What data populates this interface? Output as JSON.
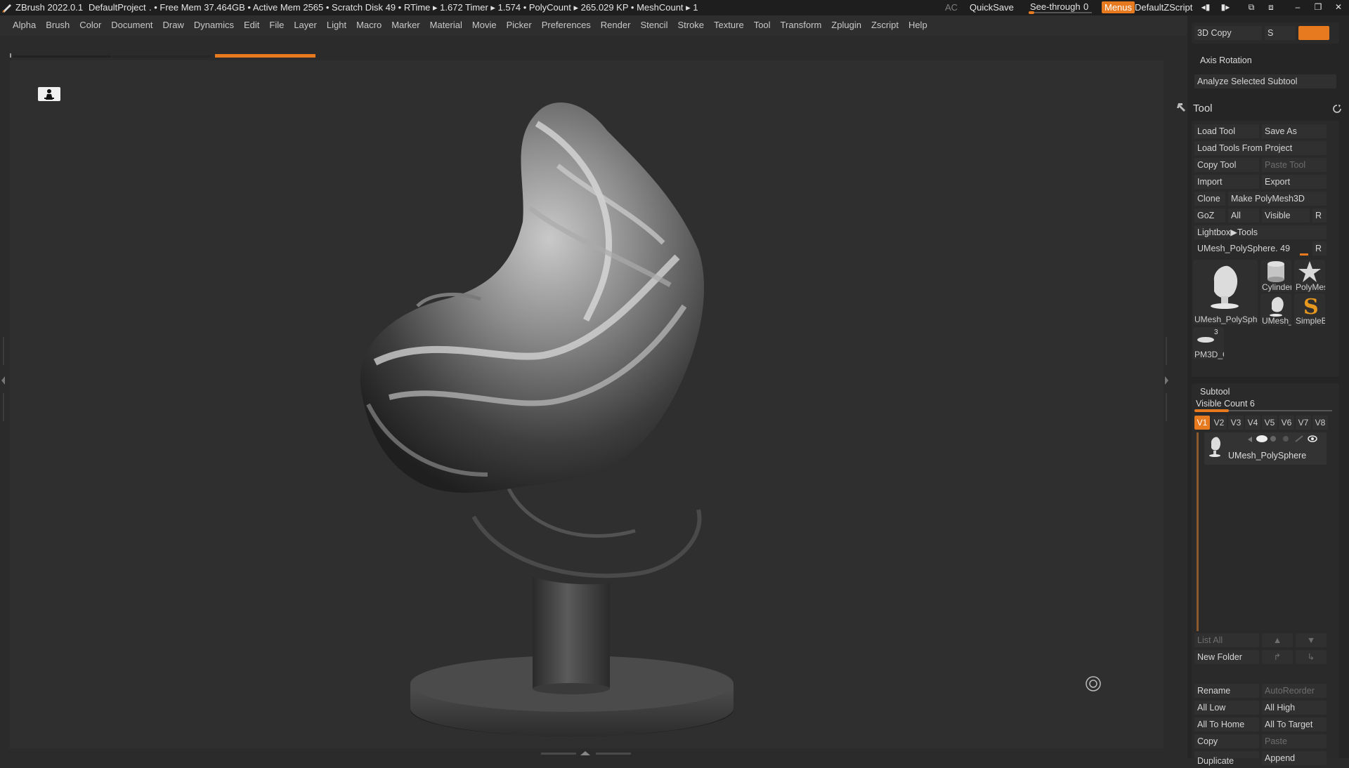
{
  "titlebar": {
    "app_title": "ZBrush 2022.0.1",
    "project": "DefaultProject",
    "stats": ". • Free Mem 37.464GB • Active Mem 2565 • Scratch Disk 49 •  RTime ▸ 1.672 Timer ▸ 1.574 • PolyCount ▸ 265.029 KP  • MeshCount ▸ 1",
    "ac": "AC",
    "quicksave": "QuickSave",
    "see_through_label": "See-through",
    "see_through_value": "0",
    "menus": "Menus",
    "script": "DefaultZScript"
  },
  "menubar": [
    "Alpha",
    "Brush",
    "Color",
    "Document",
    "Draw",
    "Dynamics",
    "Edit",
    "File",
    "Layer",
    "Light",
    "Macro",
    "Marker",
    "Material",
    "Movie",
    "Picker",
    "Preferences",
    "Render",
    "Stencil",
    "Stroke",
    "Texture",
    "Tool",
    "Transform",
    "Zplugin",
    "Zscript",
    "Help"
  ],
  "tray": {
    "top": {
      "copy3d": "3D Copy",
      "s": "S",
      "axis_rotation": "Axis Rotation",
      "analyze": "Analyze Selected Subtool"
    },
    "tool": {
      "title": "Tool",
      "load_tool": "Load Tool",
      "save_as": "Save As",
      "load_from_project": "Load Tools From Project",
      "copy_tool": "Copy Tool",
      "paste_tool": "Paste Tool",
      "import": "Import",
      "export": "Export",
      "clone": "Clone",
      "make_polymesh": "Make PolyMesh3D",
      "goz": "GoZ",
      "all": "All",
      "visible": "Visible",
      "r": "R",
      "lightbox": "Lightbox▶Tools",
      "current_tool": "UMesh_PolySphere. 49",
      "thumbs": [
        "UMesh_PolySphe",
        "Cylinder",
        "PolyMes",
        "UMesh_",
        "SimpleB",
        "PM3D_C"
      ],
      "pm3d_count": "3"
    },
    "subtool": {
      "title": "Subtool",
      "visible_count": "Visible Count 6",
      "visible_count_fraction": 0.25,
      "tabs": [
        "V1",
        "V2",
        "V3",
        "V4",
        "V5",
        "V6",
        "V7",
        "V8"
      ],
      "item": "UMesh_PolySphere",
      "list_all": "List All",
      "new_folder": "New Folder",
      "rename": "Rename",
      "autoreorder": "AutoReorder",
      "all_low": "All Low",
      "all_high": "All High",
      "all_to_home": "All To Home",
      "all_to_target": "All To Target",
      "copy": "Copy",
      "paste": "Paste",
      "append": "Append",
      "duplicate": "Duplicate"
    }
  },
  "colors": {
    "accent": "#e7791f",
    "background": "#2f2f2f",
    "panel": "#252525"
  }
}
